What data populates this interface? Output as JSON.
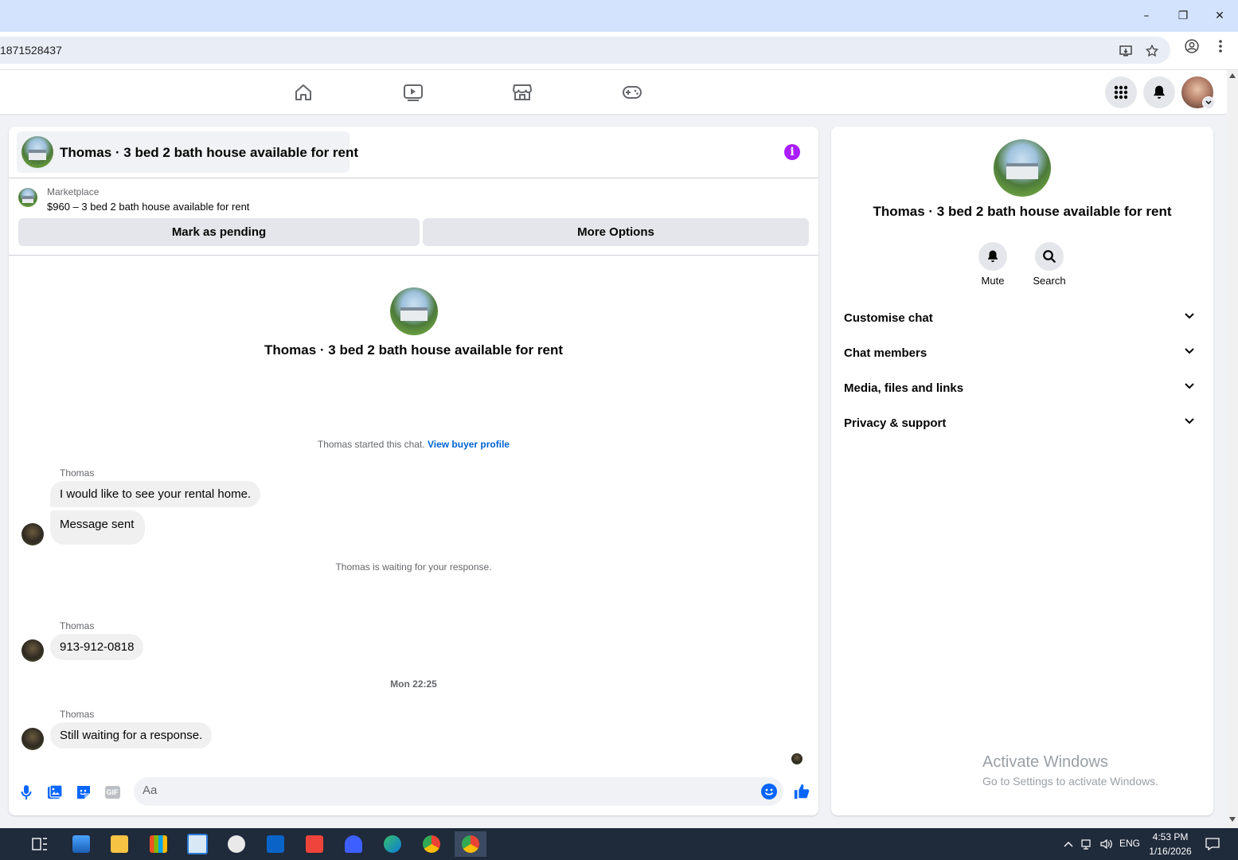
{
  "browser": {
    "url": "1871528437"
  },
  "chat": {
    "header_title": "Thomas · 3 bed 2 bath house available for rent",
    "marketplace_label": "Marketplace",
    "listing_title": "$960 – 3 bed 2 bath house available for rent",
    "mark_pending_label": "Mark as pending",
    "more_options_label": "More Options",
    "center_title": "Thomas · 3 bed 2 bath house available for rent",
    "started_text": "Thomas started this chat.",
    "view_profile_link": "View buyer profile",
    "waiting_text": "Thomas is waiting for your response.",
    "timestamp": "Mon 22:25",
    "messages": [
      {
        "sender": "Thomas",
        "texts": [
          "I would like to see your rental home.",
          "Message sent"
        ]
      },
      {
        "sender": "Thomas",
        "texts": [
          "913-912-0818"
        ]
      },
      {
        "sender": "Thomas",
        "texts": [
          "Still waiting for a response."
        ]
      }
    ],
    "composer_placeholder": "Aa",
    "gif_label": "GIF"
  },
  "details": {
    "title": "Thomas · 3 bed 2 bath house available for rent",
    "mute_label": "Mute",
    "search_label": "Search",
    "sections": [
      "Customise chat",
      "Chat members",
      "Media, files and links",
      "Privacy & support"
    ]
  },
  "watermark": {
    "line1": "Activate Windows",
    "line2": "Go to Settings to activate Windows."
  },
  "taskbar": {
    "lang": "ENG",
    "time": "4:53 PM",
    "date": "1/16/2026"
  },
  "colors": {
    "accent_blue": "#0866ff",
    "info_purple": "#a91dfc",
    "link_blue": "#0064d1"
  }
}
